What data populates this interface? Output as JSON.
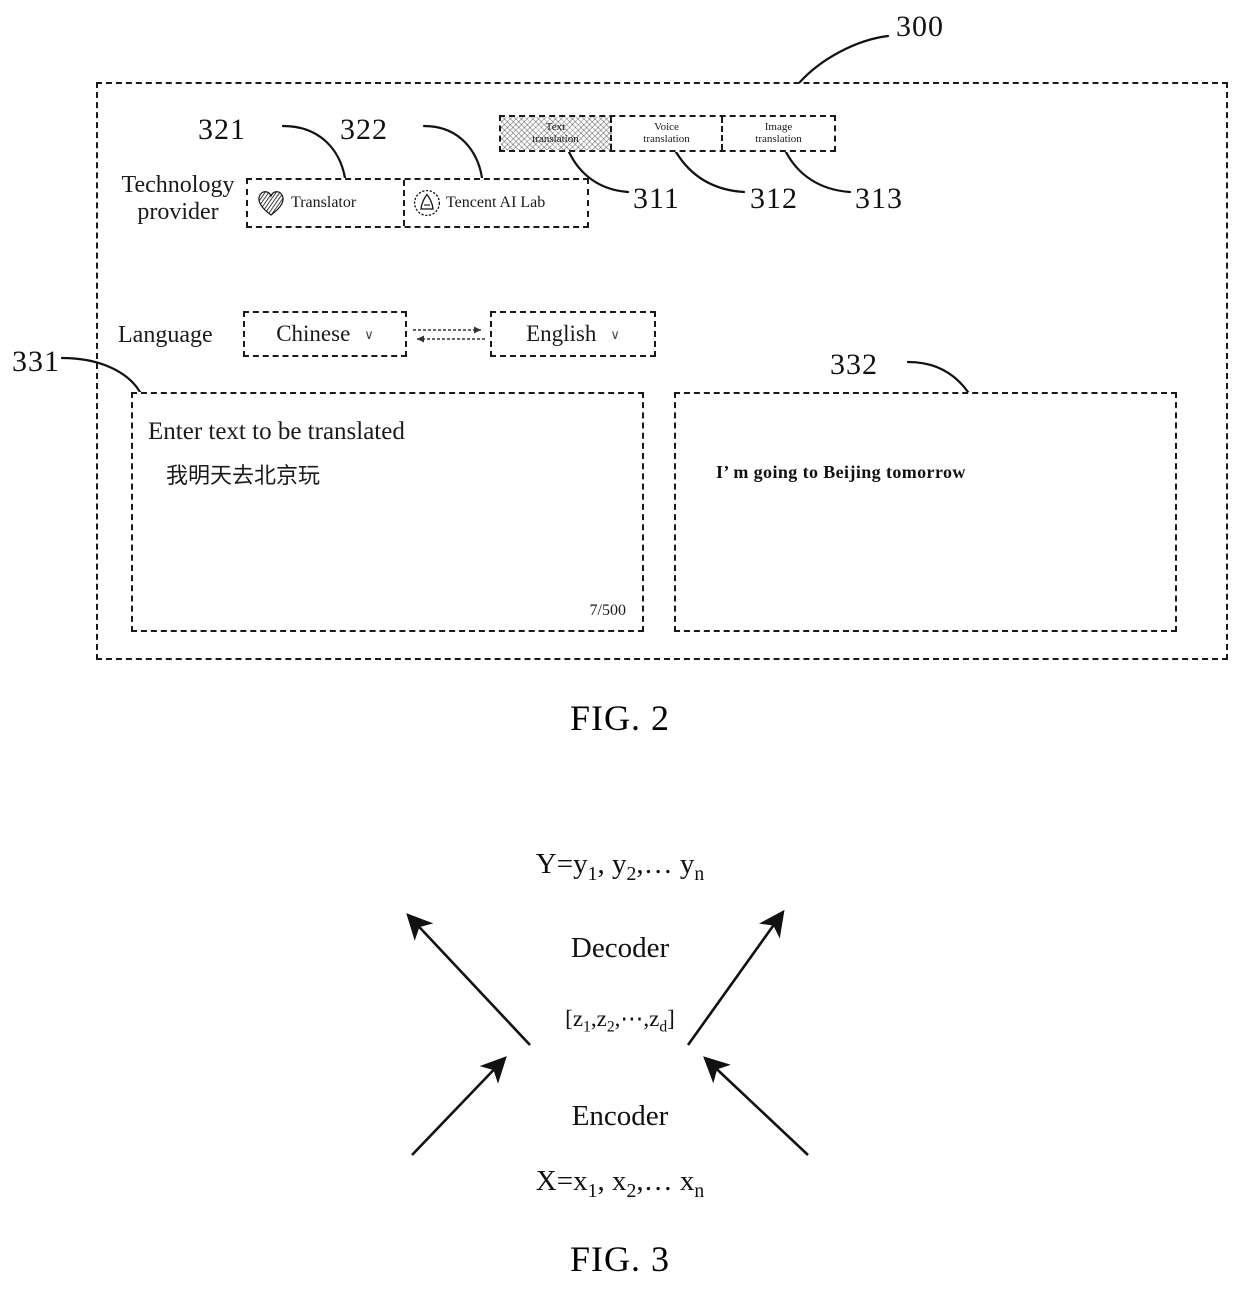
{
  "figures": {
    "fig2": {
      "caption": "FIG. 2",
      "ref_window": "300",
      "refs": {
        "provider_group": "321",
        "provider_second": "322",
        "tab_text": "311",
        "tab_voice": "312",
        "tab_image": "313",
        "input_panel": "331",
        "output_panel": "332"
      },
      "tabs": [
        {
          "line1": "Text",
          "line2": "translation",
          "selected": true
        },
        {
          "line1": "Voice",
          "line2": "translation",
          "selected": false
        },
        {
          "line1": "Image",
          "line2": "translation",
          "selected": false
        }
      ],
      "technology_provider": {
        "label_line1": "Technology",
        "label_line2": "provider",
        "options": [
          {
            "name": "Translator",
            "icon": "heart-hatched-logo-icon"
          },
          {
            "name": "Tencent AI Lab",
            "icon": "tencent-circle-logo-icon"
          }
        ]
      },
      "language": {
        "label": "Language",
        "source": "Chinese",
        "target": "English",
        "caret": "∨",
        "swap_icon": "swap-arrows-icon"
      },
      "input_panel": {
        "placeholder": "Enter text to be translated",
        "value": "我明天去北京玩",
        "char_count": "7/500"
      },
      "output_panel": {
        "value": "I’ m going to Beijing tomorrow"
      }
    },
    "fig3": {
      "caption": "FIG. 3",
      "output_label_prefix": "Y=y",
      "output_sequence": "Y=y1, y2,… yn",
      "decoder_label": "Decoder",
      "latent_label": "[z1,z2,⋯,zd]",
      "encoder_label": "Encoder",
      "input_sequence": "X=x1, x2,… xn"
    }
  }
}
